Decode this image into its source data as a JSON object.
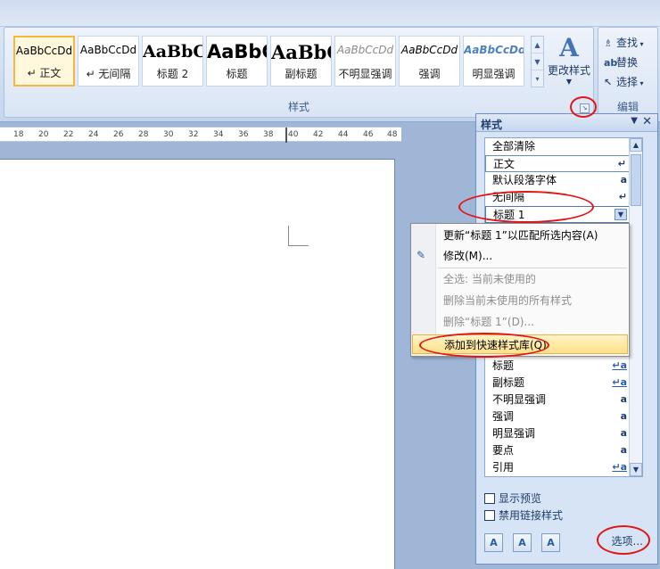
{
  "ribbon": {
    "gallery": [
      {
        "sample": "AaBbCcDd",
        "name": "↵ 正文",
        "cls": "s-normal",
        "selected": true
      },
      {
        "sample": "AaBbCcDd",
        "name": "↵ 无间隔",
        "cls": "s-normal"
      },
      {
        "sample": "AaBbC",
        "name": "标题 2",
        "cls": "s-h2"
      },
      {
        "sample": "AaBbC",
        "name": "标题",
        "cls": "s-title"
      },
      {
        "sample": "AaBbC",
        "name": "副标题",
        "cls": "s-sub"
      },
      {
        "sample": "AaBbCcDd",
        "name": "不明显强调",
        "cls": "s-subtle"
      },
      {
        "sample": "AaBbCcDd",
        "name": "强调",
        "cls": "s-emph"
      },
      {
        "sample": "AaBbCcDd",
        "name": "明显强调",
        "cls": "s-intense"
      }
    ],
    "change_styles_icon": "A",
    "change_styles_label": "更改样式",
    "group_label": "样式",
    "edit": {
      "find": "查找",
      "replace": "替换",
      "select": "选择",
      "group_label": "编辑"
    }
  },
  "ruler": {
    "ticks": [
      "18",
      "20",
      "22",
      "24",
      "26",
      "28",
      "30",
      "32",
      "34",
      "36",
      "38",
      "40",
      "42",
      "44",
      "46",
      "48"
    ]
  },
  "pane": {
    "title": "样式",
    "top_items": [
      {
        "label": "全部清除",
        "mark": ""
      },
      {
        "label": "正文",
        "mark": "↵"
      },
      {
        "label": "默认段落字体",
        "mark": "a"
      },
      {
        "label": "无间隔",
        "mark": "↵"
      },
      {
        "label": "标题 1",
        "mark": ""
      }
    ],
    "bottom_items": [
      {
        "label": "标题",
        "mark": "↵a",
        "link": true
      },
      {
        "label": "副标题",
        "mark": "↵a",
        "link": true
      },
      {
        "label": "不明显强调",
        "mark": "a"
      },
      {
        "label": "强调",
        "mark": "a"
      },
      {
        "label": "明显强调",
        "mark": "a"
      },
      {
        "label": "要点",
        "mark": "a"
      },
      {
        "label": "引用",
        "mark": "↵a",
        "link": true
      }
    ],
    "show_preview": "显示预览",
    "disable_linked": "禁用链接样式",
    "options": "选项..."
  },
  "context_menu": {
    "update": "更新“标题 1”以匹配所选内容(A)",
    "modify": "修改(M)...",
    "select_all": "全选: 当前未使用的",
    "remove_unused": "删除当前未使用的所有样式",
    "delete": "删除“标题 1”(D)...",
    "add_to_gallery": "添加到快速样式库(Q)"
  },
  "annotation_color": "#e31414"
}
